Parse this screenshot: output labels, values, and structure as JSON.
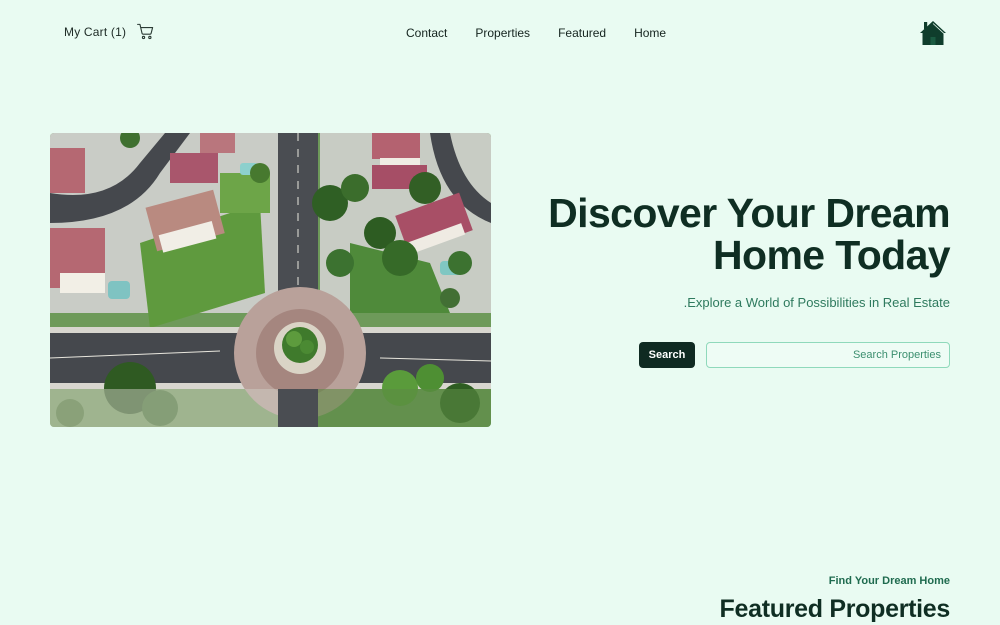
{
  "header": {
    "cart_label": "My Cart (1)",
    "cart_icon": "cart-icon",
    "nav": [
      {
        "label": "Contact"
      },
      {
        "label": "Properties"
      },
      {
        "label": "Featured"
      },
      {
        "label": "Home"
      }
    ],
    "logo_icon": "house-icon"
  },
  "hero": {
    "title_line1": "Discover Your Dream",
    "title_line2": "Home Today",
    "subtitle": ".Explore a World of Possibilities in Real Estate",
    "search_button": "Search",
    "search_placeholder": "Search Properties"
  },
  "featured": {
    "kicker": "Find Your Dream Home",
    "title": "Featured Properties"
  },
  "colors": {
    "background": "#e9fbf2",
    "primary_dark": "#0f2a22",
    "accent_green": "#2e7a5e",
    "input_border": "#8fd9bb"
  }
}
